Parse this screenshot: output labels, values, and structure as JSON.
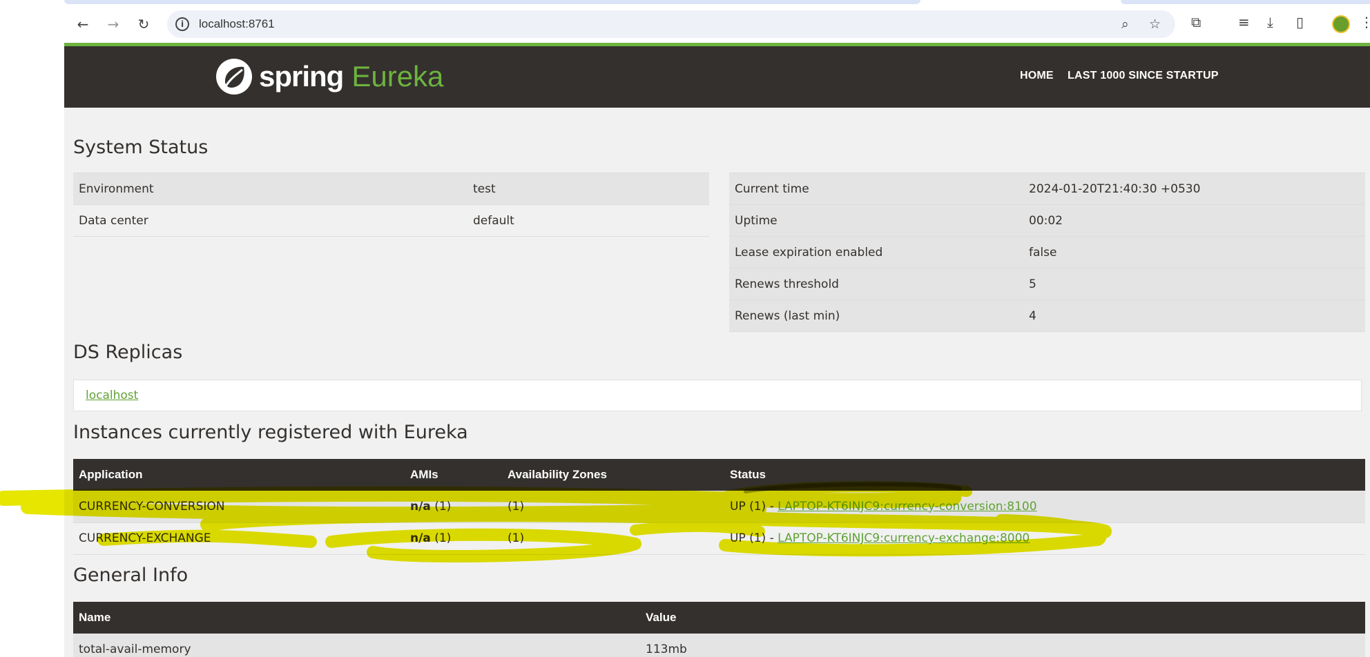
{
  "browser": {
    "url": "localhost:8761",
    "back_icon": "arrow-left-icon",
    "forward_icon": "arrow-right-icon",
    "reload_icon": "reload-icon"
  },
  "header": {
    "brand_spring": "spring",
    "brand_eureka": "Eureka",
    "nav_home": "HOME",
    "nav_last": "LAST 1000 SINCE STARTUP"
  },
  "system_status": {
    "title": "System Status",
    "left": [
      {
        "label": "Environment",
        "value": "test"
      },
      {
        "label": "Data center",
        "value": "default"
      }
    ],
    "right": [
      {
        "label": "Current time",
        "value": "2024-01-20T21:40:30 +0530"
      },
      {
        "label": "Uptime",
        "value": "00:02"
      },
      {
        "label": "Lease expiration enabled",
        "value": "false"
      },
      {
        "label": "Renews threshold",
        "value": "5"
      },
      {
        "label": "Renews (last min)",
        "value": "4"
      }
    ]
  },
  "replicas": {
    "title": "DS Replicas",
    "link": "localhost"
  },
  "instances": {
    "title": "Instances currently registered with Eureka",
    "columns": [
      "Application",
      "AMIs",
      "Availability Zones",
      "Status"
    ],
    "rows": [
      {
        "app": "CURRENCY-CONVERSION",
        "ami_bold": "n/a",
        "ami_count": "(1)",
        "zones": "(1)",
        "status": "UP (1) - ",
        "link": "LAPTOP-KT6INJC9:currency-conversion:8100"
      },
      {
        "app": "CURRENCY-EXCHANGE",
        "ami_bold": "n/a",
        "ami_count": "(1)",
        "zones": "(1)",
        "status": "UP (1) - ",
        "link": "LAPTOP-KT6INJC9:currency-exchange:8000"
      }
    ]
  },
  "general_info": {
    "title": "General Info",
    "columns": [
      "Name",
      "Value"
    ],
    "rows": [
      {
        "name": "total-avail-memory",
        "value": "113mb"
      }
    ]
  },
  "colors": {
    "header_bg": "#34302d",
    "accent_green": "#6db33f",
    "highlight_yellow": "#e8e800"
  }
}
